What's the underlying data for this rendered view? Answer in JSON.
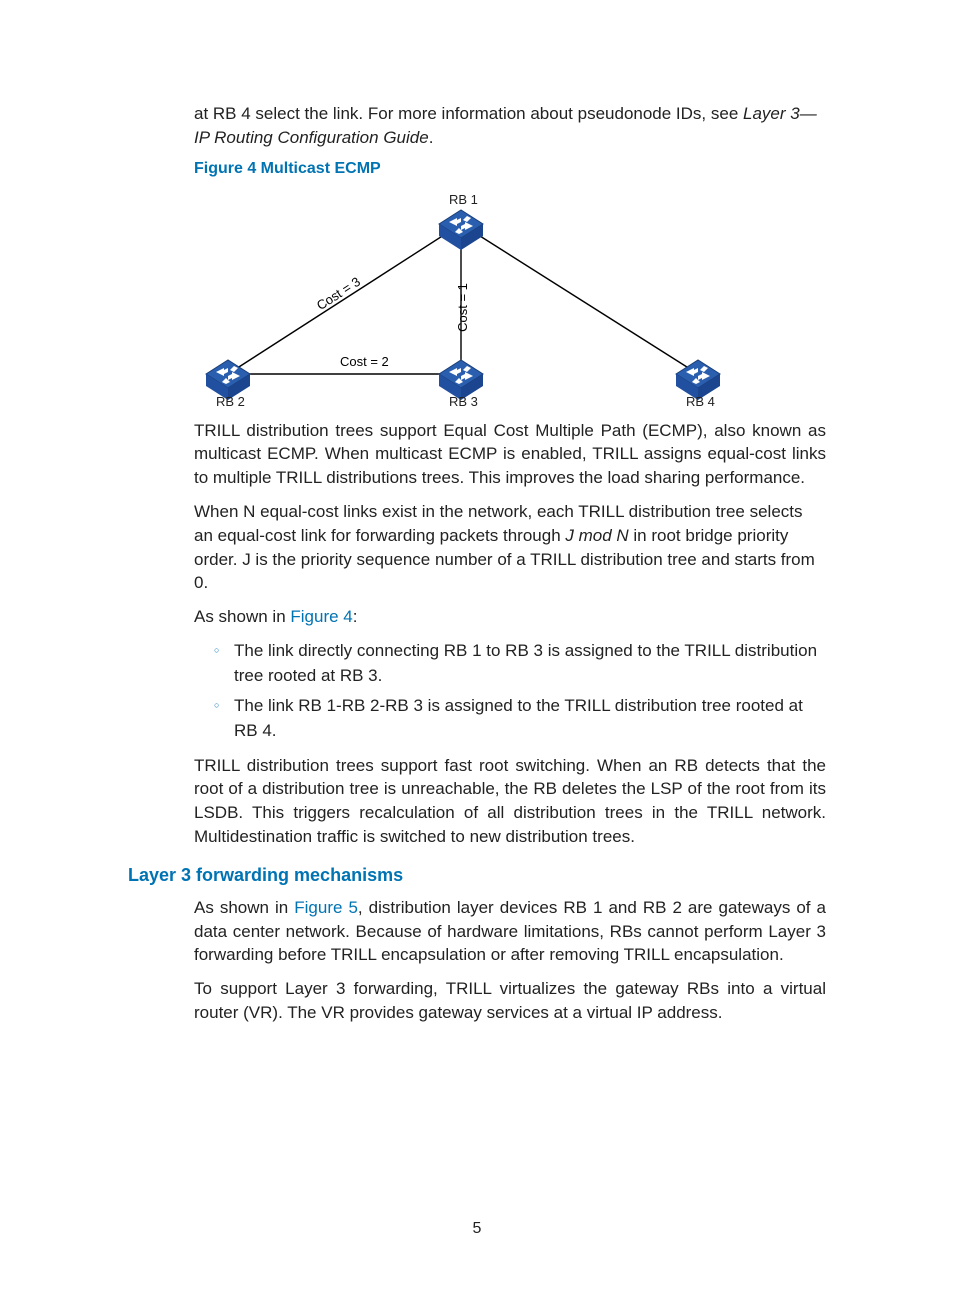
{
  "intro": {
    "p1a": "at RB 4 select the link. For more information about pseudonode IDs, see ",
    "p1_italic": "Layer 3—IP Routing Configuration Guide",
    "p1b": "."
  },
  "figure": {
    "title": "Figure 4 Multicast ECMP",
    "nodes": {
      "rb1": "RB 1",
      "rb2": "RB 2",
      "rb3": "RB 3",
      "rb4": "RB 4"
    },
    "costs": {
      "c13": "Cost = 1",
      "c12": "Cost = 3",
      "c23": "Cost = 2"
    }
  },
  "body": {
    "p2": "TRILL distribution trees support Equal Cost Multiple Path (ECMP), also known as multicast ECMP. When multicast ECMP is enabled, TRILL assigns equal-cost links to multiple TRILL distributions trees. This improves the load sharing performance.",
    "p3a": "When N equal-cost links exist in the network, each TRILL distribution tree selects an equal-cost link for forwarding packets through ",
    "p3_italic": "J mod N",
    "p3b": " in root bridge priority order. J is the priority sequence number of a TRILL distribution tree and starts from 0.",
    "p4a": "As shown in ",
    "p4_link": "Figure 4",
    "p4b": ":",
    "li1": "The link directly connecting RB 1 to RB 3 is assigned to the TRILL distribution tree rooted at RB 3.",
    "li2": "The link RB 1-RB 2-RB 3 is assigned to the TRILL distribution tree rooted at RB 4.",
    "p5": "TRILL distribution trees support fast root switching. When an RB detects that the root of a distribution tree is unreachable, the RB deletes the LSP of the root from its LSDB. This triggers recalculation of all distribution trees in the TRILL network. Multidestination traffic is switched to new distribution trees."
  },
  "section2": {
    "title": "Layer 3 forwarding mechanisms",
    "p6a": "As shown in ",
    "p6_link": "Figure 5",
    "p6b": ", distribution layer devices RB 1 and RB 2 are gateways of a data center network. Because of hardware limitations, RBs cannot perform Layer 3 forwarding before TRILL encapsulation or after removing TRILL encapsulation.",
    "p7": "To support Layer 3 forwarding, TRILL virtualizes the gateway RBs into a virtual router (VR). The VR provides gateway services at a virtual IP address."
  },
  "page_number": "5"
}
